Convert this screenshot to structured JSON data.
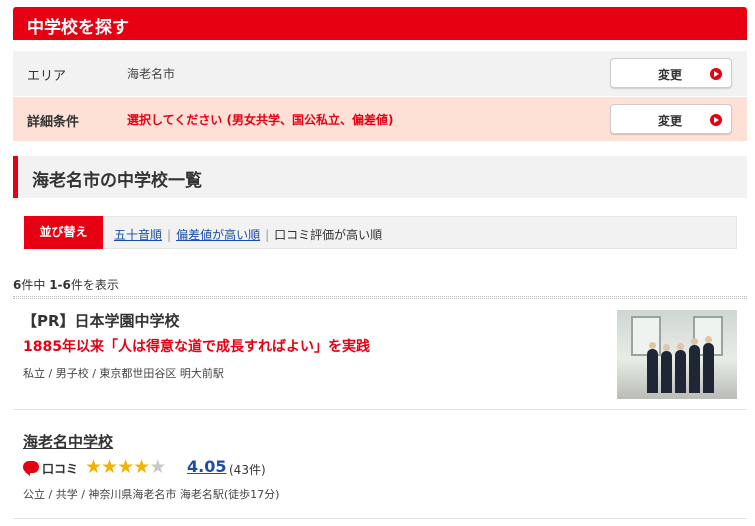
{
  "header": {
    "title": "中学校を探す"
  },
  "conditions": {
    "area": {
      "label": "エリア",
      "value": "海老名市",
      "button": "変更"
    },
    "detail": {
      "label": "詳細条件",
      "value": "選択してください (男女共学、国公私立、偏差値)",
      "button": "変更"
    }
  },
  "section": {
    "title": "海老名市の中学校一覧"
  },
  "sort": {
    "label": "並び替え",
    "options": [
      "五十音順",
      "偏差値が高い順",
      "口コミ評価が高い順"
    ],
    "separator": "|"
  },
  "results": {
    "total": "6",
    "total_suffix": "件中 ",
    "range": "1-6",
    "range_suffix": "件を表示"
  },
  "schools": [
    {
      "name": "【PR】日本学園中学校",
      "catch": "1885年以来「人は得意な道で成長すればよい」を実践",
      "meta": "私立 / 男子校 / 東京都世田谷区 明大前駅"
    },
    {
      "name": "海老名中学校",
      "review_label": "口コミ",
      "rating": 4.05,
      "rating_text": "4.05",
      "review_count": "(43件)",
      "meta": "公立 / 共学 / 神奈川県海老名市 海老名駅(徒歩17分)"
    }
  ],
  "colors": {
    "accent": "#e60012",
    "link": "#1a4ea8",
    "star": "#f0b400",
    "detail_bg": "#fde0d6"
  },
  "icons": {
    "change_button": "arrow-right-circle-icon",
    "review": "speech-bubble-icon",
    "rating": "star-icon"
  }
}
